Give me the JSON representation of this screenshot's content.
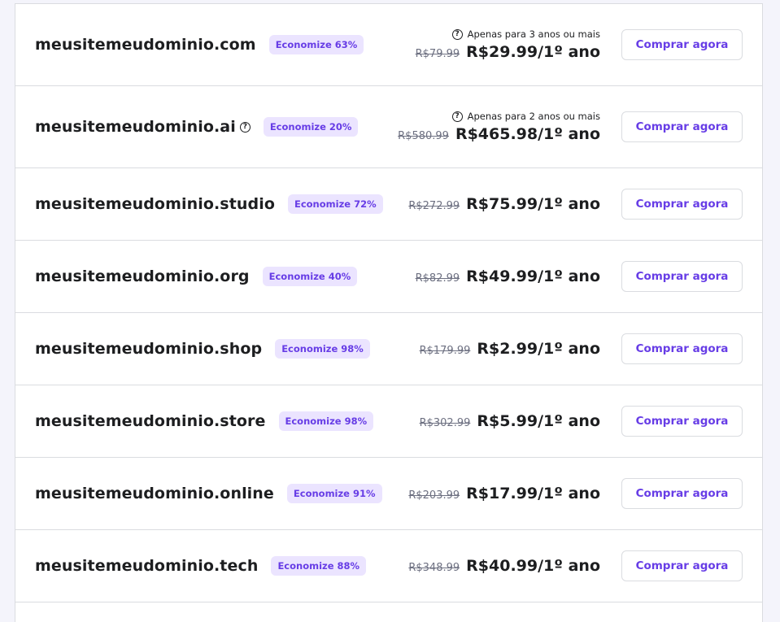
{
  "rows": [
    {
      "domain": "meusitemeudominio.com",
      "badge": "Economize 63%",
      "note": "Apenas para 3 anos ou mais",
      "old_price": "R$79.99",
      "new_price": "R$29.99/1º ano",
      "button": "Comprar agora"
    },
    {
      "domain": "meusitemeudominio.ai",
      "badge": "Economize 20%",
      "note": "Apenas para 2 anos ou mais",
      "old_price": "R$580.99",
      "new_price": "R$465.98/1º ano",
      "button": "Comprar agora"
    },
    {
      "domain": "meusitemeudominio.studio",
      "badge": "Economize 72%",
      "old_price": "R$272.99",
      "new_price": "R$75.99/1º ano",
      "button": "Comprar agora"
    },
    {
      "domain": "meusitemeudominio.org",
      "badge": "Economize 40%",
      "old_price": "R$82.99",
      "new_price": "R$49.99/1º ano",
      "button": "Comprar agora"
    },
    {
      "domain": "meusitemeudominio.shop",
      "badge": "Economize 98%",
      "old_price": "R$179.99",
      "new_price": "R$2.99/1º ano",
      "button": "Comprar agora"
    },
    {
      "domain": "meusitemeudominio.store",
      "badge": "Economize 98%",
      "old_price": "R$302.99",
      "new_price": "R$5.99/1º ano",
      "button": "Comprar agora"
    },
    {
      "domain": "meusitemeudominio.online",
      "badge": "Economize 91%",
      "old_price": "R$203.99",
      "new_price": "R$17.99/1º ano",
      "button": "Comprar agora"
    },
    {
      "domain": "meusitemeudominio.tech",
      "badge": "Economize 88%",
      "old_price": "R$348.99",
      "new_price": "R$40.99/1º ano",
      "button": "Comprar agora"
    }
  ],
  "icons": {
    "help": "question-circle-icon"
  },
  "colors": {
    "accent": "#673de6",
    "badge_bg": "#ebe4ff",
    "text": "#1d1e20",
    "muted": "#6d7081"
  }
}
